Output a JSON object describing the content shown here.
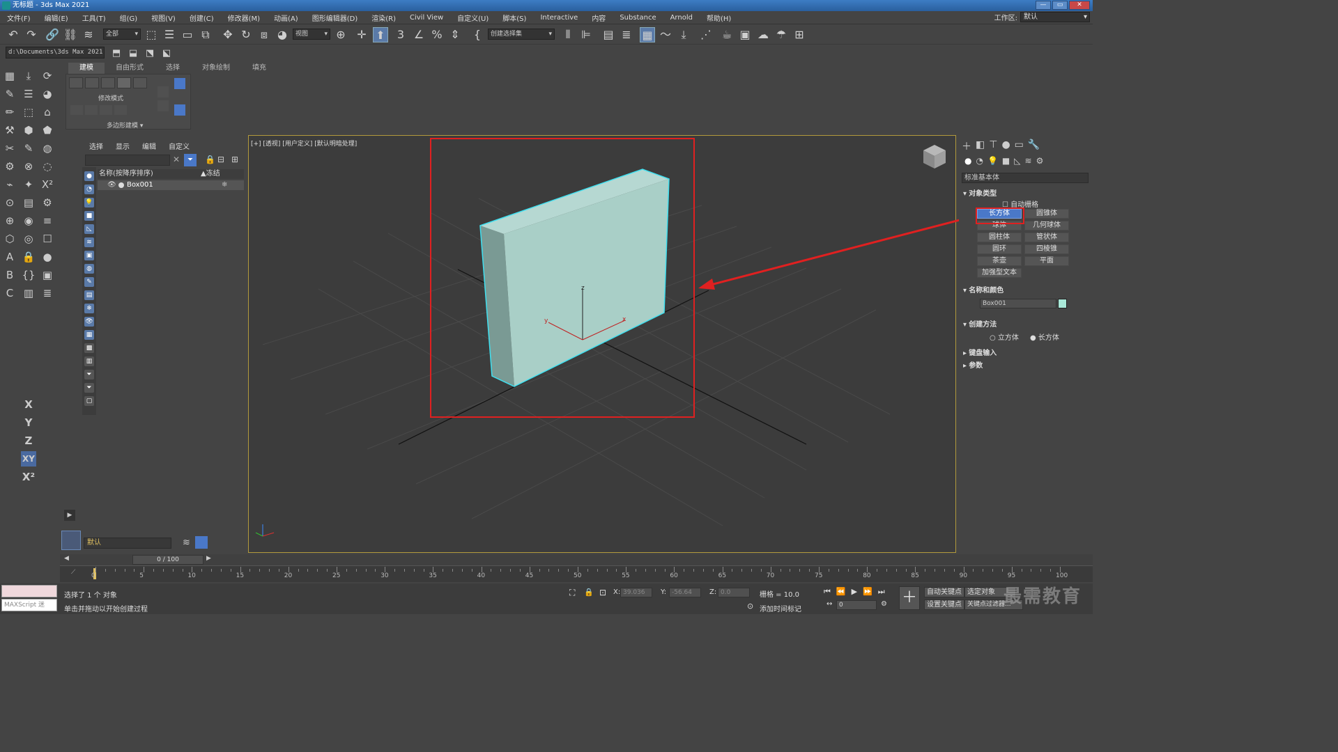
{
  "window": {
    "title": "无标题 - 3ds Max 2021",
    "buttons": [
      "—",
      "▭",
      "✕"
    ]
  },
  "menubar": {
    "items": [
      "文件(F)",
      "编辑(E)",
      "工具(T)",
      "组(G)",
      "视图(V)",
      "创建(C)",
      "修改器(M)",
      "动画(A)",
      "图形编辑器(D)",
      "渲染(R)",
      "Civil View",
      "自定义(U)",
      "脚本(S)",
      "Interactive",
      "内容",
      "Substance",
      "Arnold",
      "帮助(H)"
    ],
    "workspace_label": "工作区:",
    "workspace_value": "默认"
  },
  "toolbar": {
    "filter_select": "全部",
    "refcoord_select": "视图",
    "named_selset": "创建选择集",
    "project_path": "d:\\Documents\\3ds Max 2021"
  },
  "ribbon": {
    "tabs": [
      "建模",
      "自由形式",
      "选择",
      "对象绘制",
      "填充"
    ],
    "active_tab": "建模",
    "panel_mode": "修改模式",
    "panel_name": "多边形建模"
  },
  "explorer": {
    "menu": [
      "选择",
      "显示",
      "编辑",
      "自定义"
    ],
    "column_name": "名称(按降序排序)",
    "column_freeze": "▲冻结",
    "rows": [
      {
        "name": "Box001"
      }
    ],
    "layer_value": "默认"
  },
  "viewport": {
    "label": "[+] [透视] [用户定义] [默认明暗处理]",
    "object_color": "#a9cfc7",
    "edge_highlight": "#3fe0f0",
    "axis_labels": {
      "z": "z",
      "y": "y",
      "x": "x"
    }
  },
  "command_panel": {
    "category": "标准基本体",
    "object_type_title": "对象类型",
    "autogrid_label": "自动栅格",
    "primitives": [
      [
        "长方体",
        "圆锥体"
      ],
      [
        "球体",
        "几何球体"
      ],
      [
        "圆柱体",
        "管状体"
      ],
      [
        "圆环",
        "四棱锥"
      ],
      [
        "茶壶",
        "平面"
      ],
      [
        "加强型文本",
        ""
      ]
    ],
    "selected_primitive": "长方体",
    "name_color_title": "名称和颜色",
    "object_name": "Box001",
    "object_swatch": "#a9e8d8",
    "creation_method_title": "创建方法",
    "creation_methods": [
      "立方体",
      "长方体"
    ],
    "keyboard_entry_title": "键盘输入",
    "params_title": "参数"
  },
  "timeline": {
    "frame_display": "0 / 100",
    "ticks": [
      "0",
      "5",
      "10",
      "15",
      "20",
      "25",
      "30",
      "35",
      "40",
      "45",
      "50",
      "55",
      "60",
      "65",
      "70",
      "75",
      "80",
      "85",
      "90",
      "95",
      "100"
    ]
  },
  "statusbar": {
    "maxscript_label": "MAXScript 迷",
    "status_line1": "选择了 1 个 对象",
    "status_line2": "单击并拖动以开始创建过程",
    "x_label": "X:",
    "x_value": "39.036",
    "y_label": "Y:",
    "y_value": "-56.64",
    "z_label": "Z:",
    "z_value": "0.0",
    "grid_label": "栅格 = 10.0",
    "add_time_tag": "添加时间标记",
    "auto_key": "自动关键点",
    "set_key": "设置关键点",
    "selected_object": "选定对象",
    "key_filters": "关键点过滤器...",
    "frame_spinner": "0"
  },
  "watermark": "最需教育"
}
